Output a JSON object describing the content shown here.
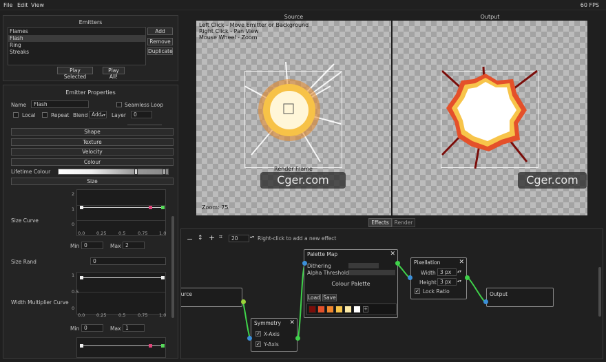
{
  "menu": {
    "file": "File",
    "edit": "Edit",
    "view": "View",
    "fps": "60 FPS"
  },
  "emitters": {
    "title": "Emitters",
    "items": [
      "Flames",
      "Flash",
      "Ring",
      "Streaks"
    ],
    "selected_index": 1,
    "add": "Add",
    "remove": "Remove",
    "duplicate": "Duplicate",
    "play_selected": "Play Selected",
    "play_all": "Play All!"
  },
  "props": {
    "title": "Emitter Properties",
    "name_label": "Name",
    "name_value": "Flash",
    "seamless": "Seamless Loop",
    "local": "Local",
    "repeat": "Repeat",
    "blend_label": "Blend",
    "blend_value": "Add",
    "layer_label": "Layer",
    "layer_value": "0",
    "sections": [
      "Shape",
      "Texture",
      "Velocity",
      "Colour"
    ],
    "lifetime_colour": "Lifetime Colour",
    "size_section": "Size",
    "size_curve": "Size Curve",
    "size_rand": "Size Rand",
    "size_rand_value": "0",
    "width_curve": "Width Multiplier Curve",
    "min_label": "Min",
    "max_label": "Max",
    "size_min": "0",
    "size_max": "2",
    "width_min": "0",
    "width_max": "1",
    "x_ticks": [
      "0.0",
      "0.25",
      "0.5",
      "0.75",
      "1.0"
    ],
    "size_y_ticks": [
      "2",
      "1",
      "0"
    ],
    "width_y_ticks": [
      "1",
      "0.5",
      "0"
    ]
  },
  "source": {
    "title": "Source",
    "help1": "Left Click - Move Emitter or Background",
    "help2": "Right Click - Pan View",
    "help3": "Mouse Wheel - Zoom",
    "render_frame": "Render Frame",
    "zoom": "Zoom: 75",
    "watermark": "Cger.com"
  },
  "output": {
    "title": "Output",
    "watermark": "Cger.com"
  },
  "tabs": {
    "effects": "Effects",
    "render": "Render",
    "active": "effects"
  },
  "effects": {
    "zoom_value": "20",
    "hint": "Right-click to add a new effect",
    "source_node": "ource",
    "symmetry": {
      "title": "Symmetry",
      "x_axis": "X-Axis",
      "y_axis": "Y-Axis"
    },
    "palette": {
      "title": "Palette Map",
      "dithering": "Dithering",
      "alpha": "Alpha Threshold",
      "colour_palette": "Colour Palette",
      "load": "Load",
      "save": "Save",
      "add": "+",
      "colors": [
        "#7a0d0a",
        "#e4502a",
        "#f0862d",
        "#f7c44a",
        "#fbe9a6",
        "#ffffff"
      ]
    },
    "pixelation": {
      "title": "Pixellation",
      "width_label": "Width",
      "width_value": "3 px",
      "height_label": "Height",
      "height_value": "3 px",
      "lock": "Lock Ratio"
    },
    "output_node": "Output",
    "accent_green": "#3fd24a",
    "accent_blue": "#3b8fd8"
  }
}
